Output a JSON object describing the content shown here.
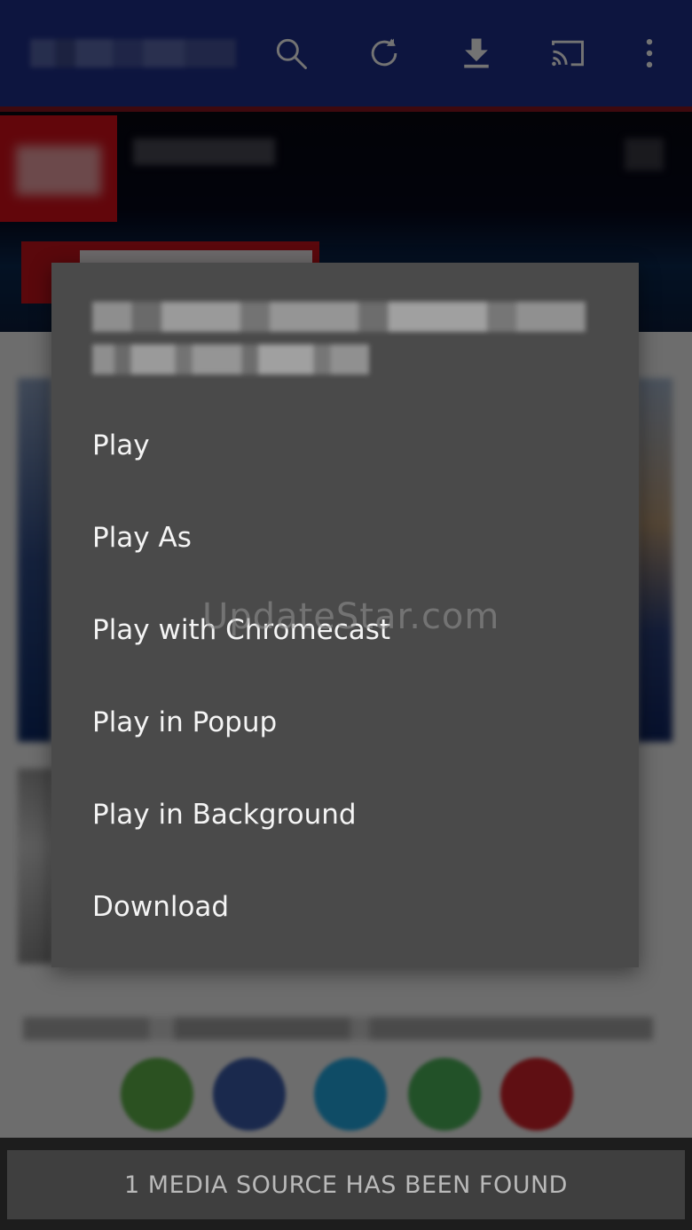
{
  "appbar": {
    "icons": [
      "search-icon",
      "refresh-icon",
      "download-icon",
      "cast-icon",
      "more-vert-icon"
    ],
    "color": "#1e2f8c"
  },
  "dialog": {
    "items": [
      {
        "label": "Play"
      },
      {
        "label": "Play As"
      },
      {
        "label": "Play with Chromecast"
      },
      {
        "label": "Play in Popup"
      },
      {
        "label": "Play in Background"
      },
      {
        "label": "Download"
      }
    ],
    "background": "#4a4a4a"
  },
  "snackbar": {
    "message": "1 MEDIA SOURCE HAS BEEN FOUND"
  },
  "watermark": {
    "text": "UpdateStar.com"
  },
  "share_icons": [
    "share-green-icon",
    "facebook-icon",
    "twitter-icon",
    "whatsapp-icon",
    "share-red-icon"
  ]
}
